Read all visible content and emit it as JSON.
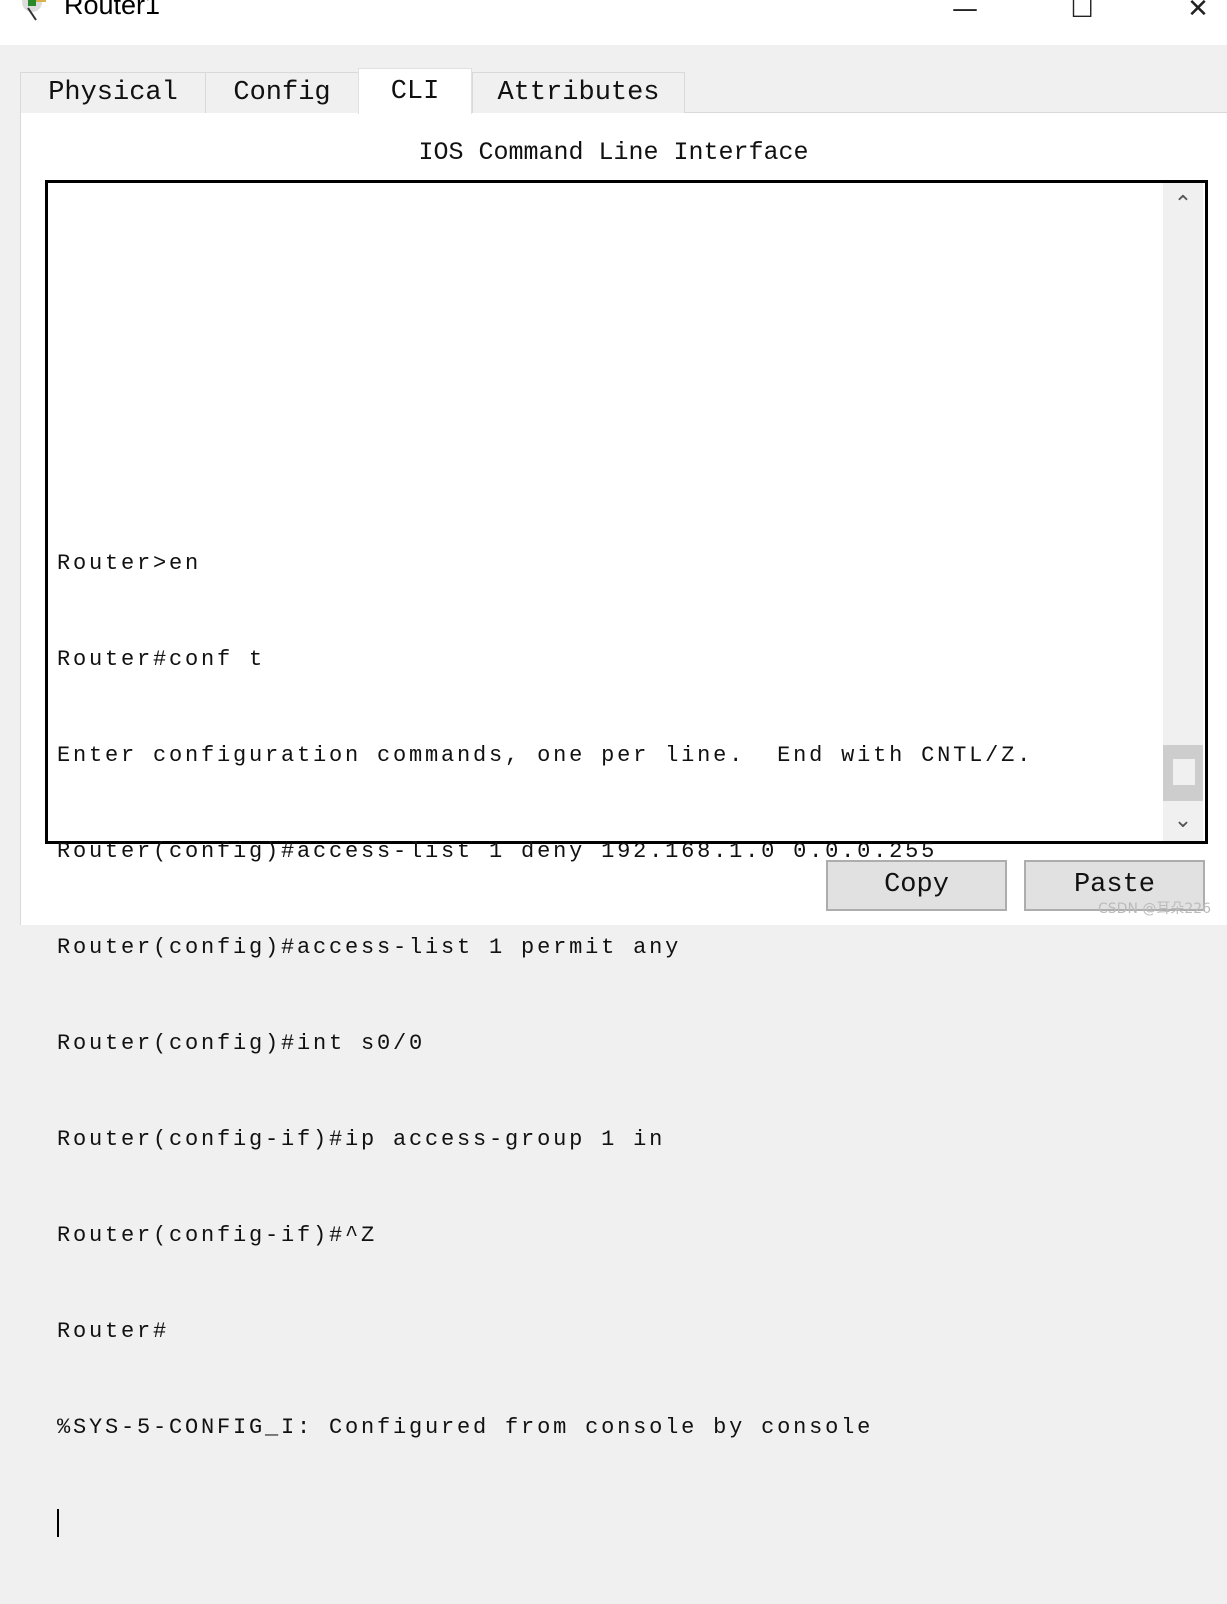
{
  "window": {
    "title": "Router1",
    "minimize_icon": "minimize-icon",
    "maximize_icon": "maximize-icon",
    "close_icon": "close-icon"
  },
  "tabs": [
    {
      "label": "Physical"
    },
    {
      "label": "Config"
    },
    {
      "label": "CLI",
      "active": true
    },
    {
      "label": "Attributes"
    }
  ],
  "cli": {
    "heading": "IOS Command Line Interface",
    "lines": [
      "Router>en",
      "Router#conf t",
      "Enter configuration commands, one per line.  End with CNTL/Z.",
      "Router(config)#access-list 1 deny 192.168.1.0 0.0.0.255",
      "Router(config)#access-list 1 permit any",
      "Router(config)#int s0/0",
      "Router(config-if)#ip access-group 1 in",
      "Router(config-if)#^Z",
      "Router#",
      "%SYS-5-CONFIG_I: Configured from console by console"
    ]
  },
  "buttons": {
    "copy": "Copy",
    "paste": "Paste"
  },
  "watermark": "CSDN @耳朵226"
}
